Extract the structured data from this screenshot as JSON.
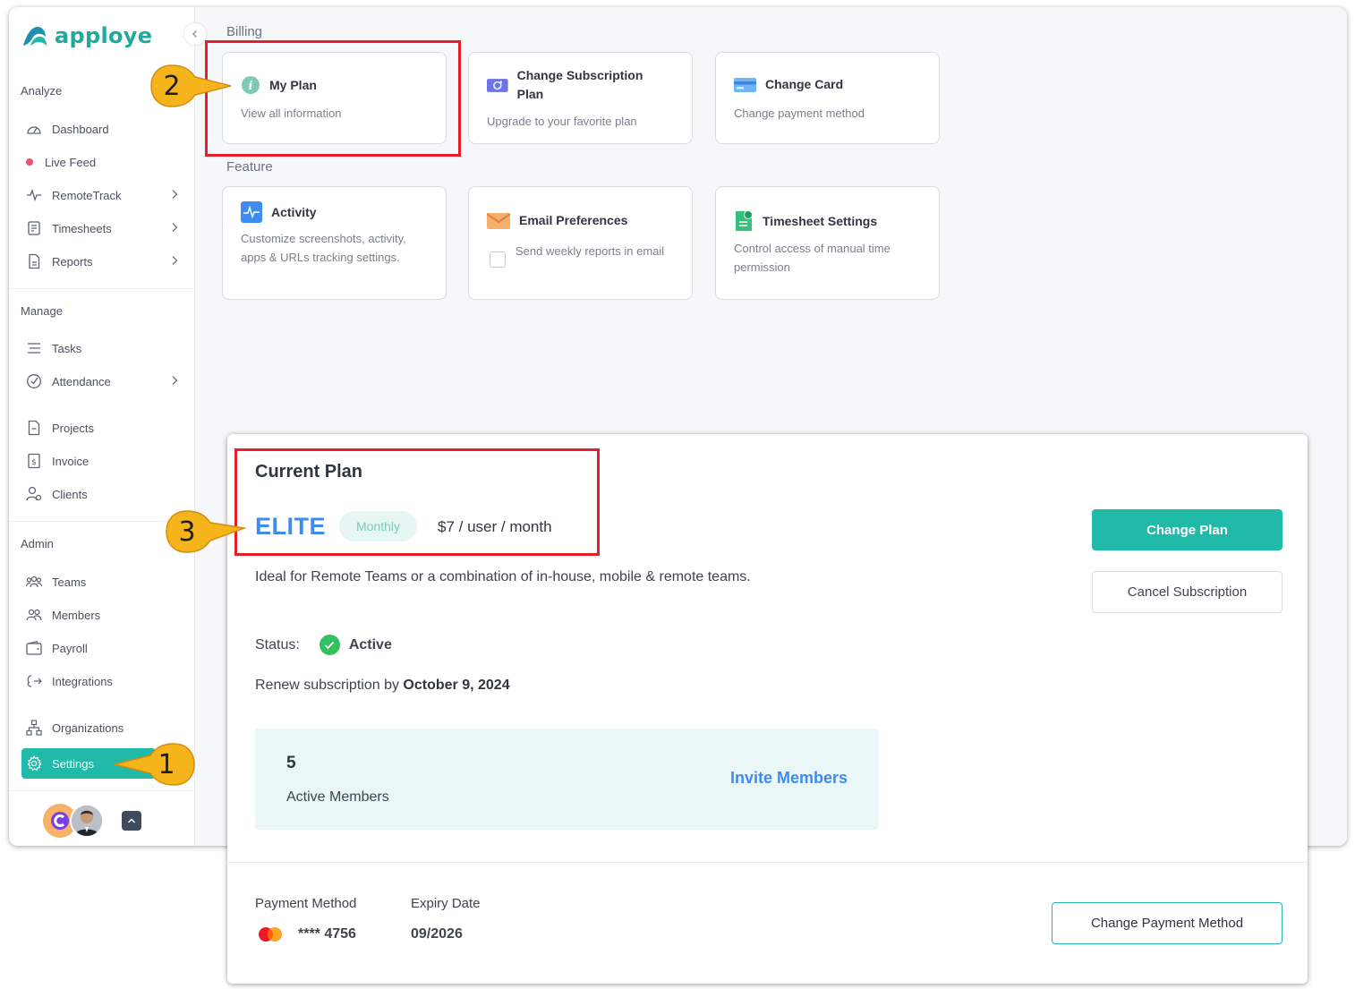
{
  "app": {
    "name": "apploye"
  },
  "colors": {
    "brand": "#21b9a8",
    "link": "#3f8cf0",
    "highlight": "#e3202a",
    "callout": "#f5b31c"
  },
  "sidebar": {
    "sections": {
      "analyze": "Analyze",
      "manage": "Manage",
      "admin": "Admin"
    },
    "items": {
      "dashboard": "Dashboard",
      "live_feed": "Live Feed",
      "remotetrack": "RemoteTrack",
      "timesheets": "Timesheets",
      "reports": "Reports",
      "tasks": "Tasks",
      "attendance": "Attendance",
      "projects": "Projects",
      "invoice": "Invoice",
      "clients": "Clients",
      "teams": "Teams",
      "members": "Members",
      "payroll": "Payroll",
      "integrations": "Integrations",
      "organizations": "Organizations",
      "settings": "Settings"
    }
  },
  "billing": {
    "label": "Billing",
    "cards": [
      {
        "title": "My Plan",
        "desc": "View all information",
        "icon": "info-icon"
      },
      {
        "title": "Change Subscription Plan",
        "desc": "Upgrade to your favorite plan",
        "icon": "subscription-icon"
      },
      {
        "title": "Change Card",
        "desc": "Change payment method",
        "icon": "card-icon"
      }
    ]
  },
  "feature": {
    "label": "Feature",
    "cards": [
      {
        "title": "Activity",
        "desc": "Customize screenshots, activity, apps & URLs tracking settings.",
        "icon": "activity-icon"
      },
      {
        "title": "Email Preferences",
        "desc": "Send weekly reports in email",
        "icon": "email-icon"
      },
      {
        "title": "Timesheet Settings",
        "desc": "Control access of manual time permission",
        "icon": "timesheet-icon"
      }
    ]
  },
  "callouts": [
    "1",
    "2",
    "3"
  ],
  "plan": {
    "title": "Current Plan",
    "name": "ELITE",
    "cycle": "Monthly",
    "price": "$7 / user / month",
    "description": "Ideal for Remote Teams or a combination of in-house, mobile & remote teams.",
    "status_label": "Status:",
    "status_value": "Active",
    "renew_prefix": "Renew subscription by ",
    "renew_date": "October 9, 2024",
    "active_members_count": "5",
    "active_members_label": "Active Members",
    "invite_label": "Invite Members",
    "change_plan_label": "Change Plan",
    "cancel_label": "Cancel Subscription",
    "payment_method_label": "Payment Method",
    "card_number": "**** 4756",
    "expiry_label": "Expiry Date",
    "expiry_value": "09/2026",
    "change_payment_label": "Change Payment Method"
  }
}
